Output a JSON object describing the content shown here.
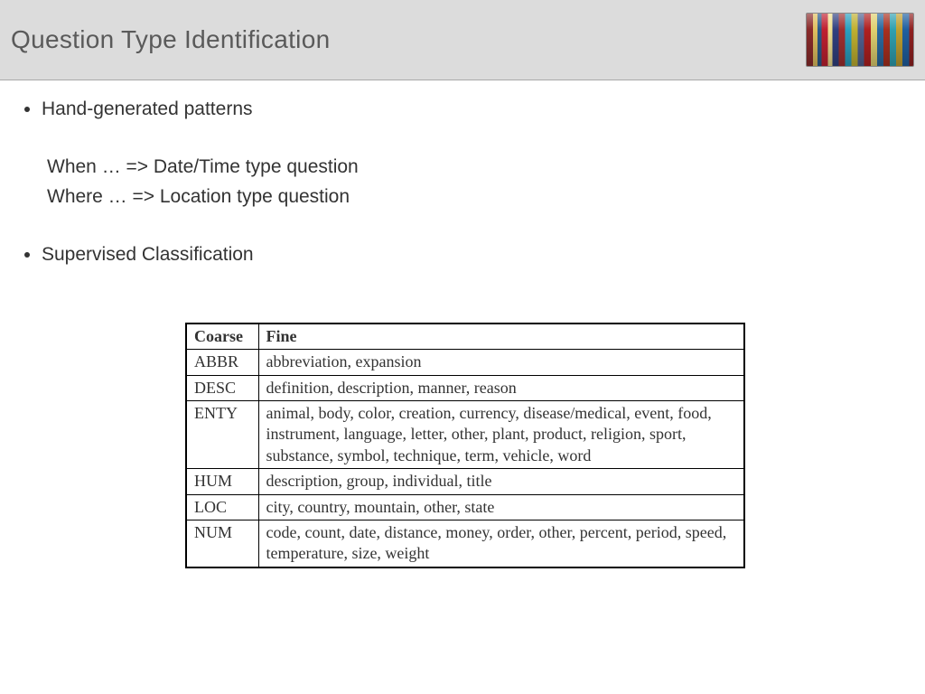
{
  "header": {
    "title": "Question Type Identification",
    "image_alt": "bookshelf-photo"
  },
  "bullets": {
    "item1": "Hand-generated patterns",
    "example1": "When … => Date/Time type question",
    "example2": "Where … => Location type question",
    "item2": "Supervised Classification"
  },
  "table": {
    "headers": {
      "coarse": "Coarse",
      "fine": "Fine"
    },
    "rows": [
      {
        "coarse": "ABBR",
        "fine": "abbreviation, expansion"
      },
      {
        "coarse": "DESC",
        "fine": "definition, description, manner, reason"
      },
      {
        "coarse": "ENTY",
        "fine": "animal, body, color, creation, currency, disease/medical, event, food, instrument, language, letter, other, plant, product, religion, sport, substance, symbol, technique, term, vehicle, word"
      },
      {
        "coarse": "HUM",
        "fine": "description, group, individual, title"
      },
      {
        "coarse": "LOC",
        "fine": "city, country, mountain, other, state"
      },
      {
        "coarse": "NUM",
        "fine": "code, count, date, distance, money, order, other, percent, period, speed, temperature, size, weight"
      }
    ]
  }
}
